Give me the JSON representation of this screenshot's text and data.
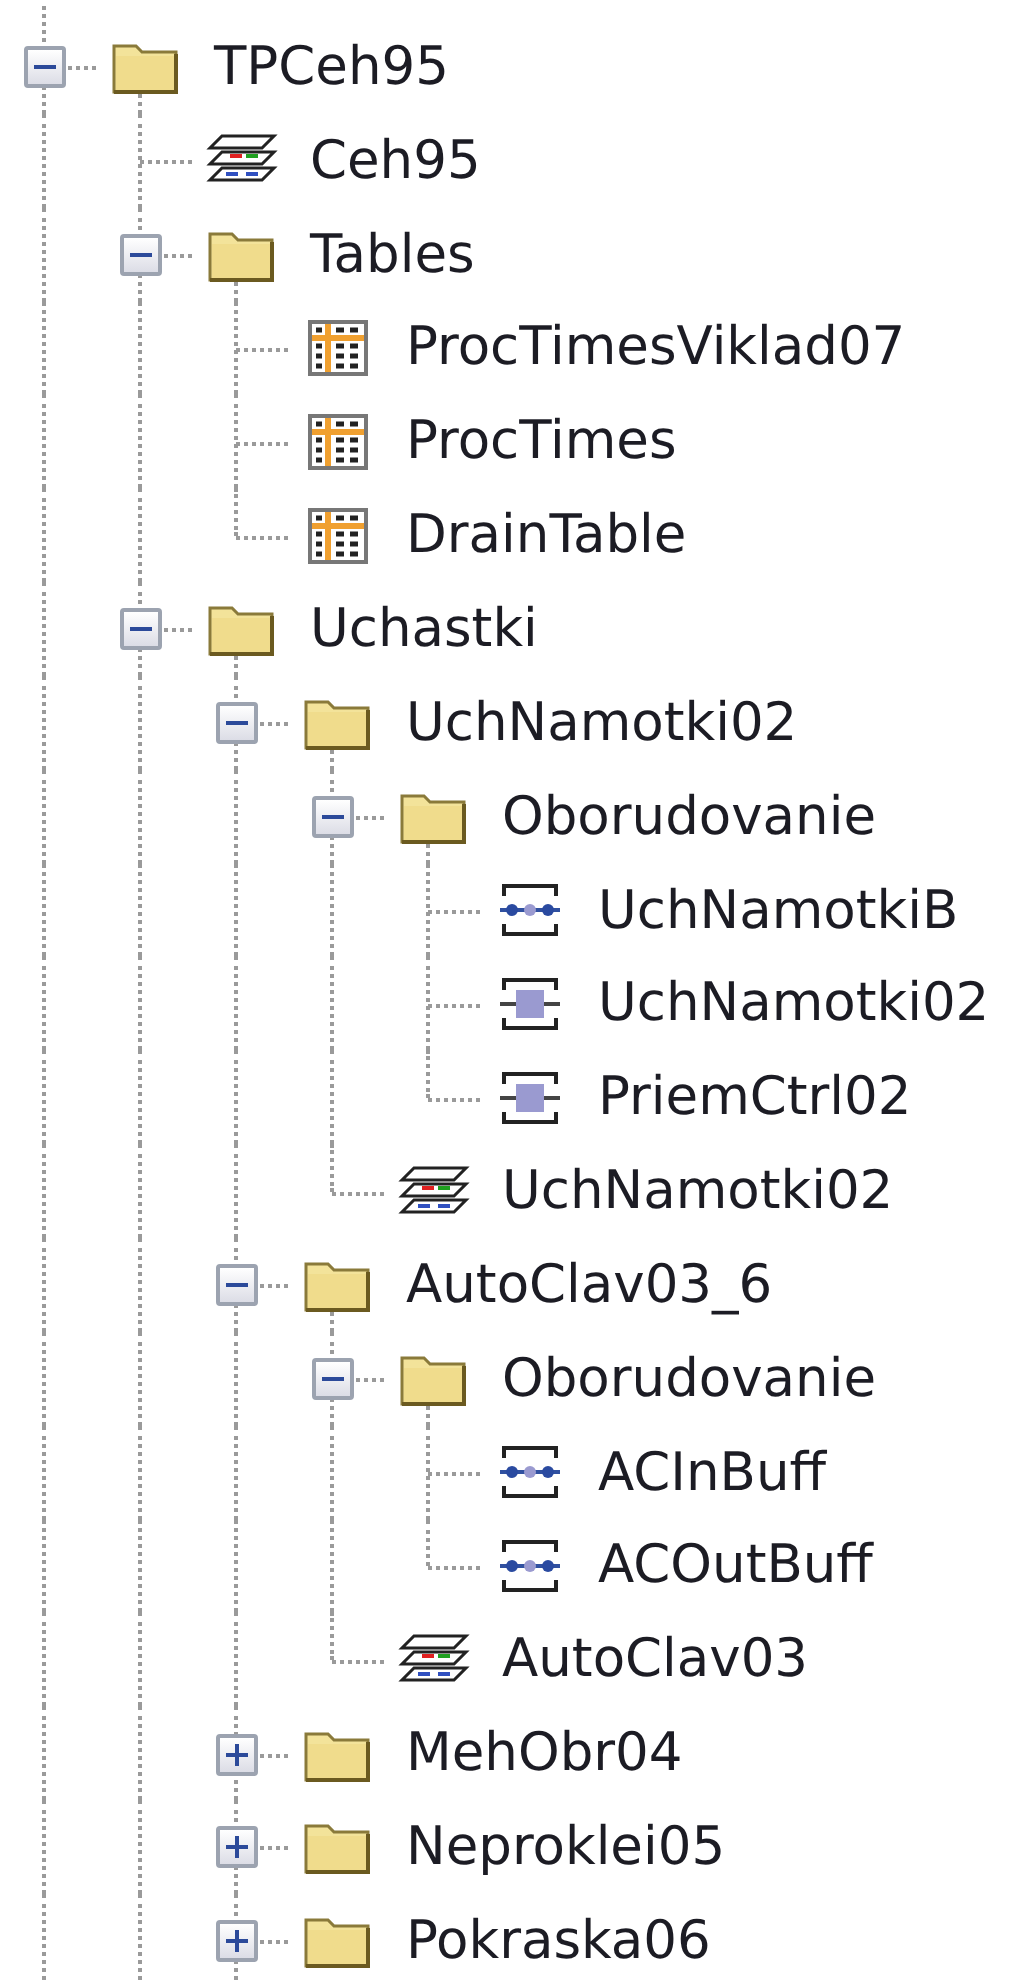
{
  "tree": [
    {
      "kind": "folder",
      "label": "TPCeh95",
      "expanded": true,
      "children": [
        {
          "kind": "diagram",
          "label": "Ceh95"
        },
        {
          "kind": "folder",
          "label": "Tables",
          "expanded": true,
          "children": [
            {
              "kind": "table",
              "label": "ProcTimesViklad07"
            },
            {
              "kind": "table",
              "label": "ProcTimes"
            },
            {
              "kind": "table",
              "label": "DrainTable"
            }
          ]
        },
        {
          "kind": "folder",
          "label": "Uchastki",
          "expanded": true,
          "children": [
            {
              "kind": "folder",
              "label": "UchNamotki02",
              "expanded": true,
              "children": [
                {
                  "kind": "folder",
                  "label": "Oborudovanie",
                  "expanded": true,
                  "children": [
                    {
                      "kind": "connector",
                      "label": "UchNamotkiB"
                    },
                    {
                      "kind": "block",
                      "label": "UchNamotki02"
                    },
                    {
                      "kind": "block",
                      "label": "PriemCtrl02"
                    }
                  ]
                },
                {
                  "kind": "diagram",
                  "label": "UchNamotki02"
                }
              ]
            },
            {
              "kind": "folder",
              "label": "AutoClav03_6",
              "expanded": true,
              "children": [
                {
                  "kind": "folder",
                  "label": "Oborudovanie",
                  "expanded": true,
                  "children": [
                    {
                      "kind": "connector",
                      "label": "ACInBuff"
                    },
                    {
                      "kind": "connector",
                      "label": "ACOutBuff"
                    }
                  ]
                },
                {
                  "kind": "diagram",
                  "label": "AutoClav03"
                }
              ]
            },
            {
              "kind": "folder",
              "label": "MehObr04",
              "expanded": false
            },
            {
              "kind": "folder",
              "label": "Neproklei05",
              "expanded": false
            },
            {
              "kind": "folder",
              "label": "Pokraska06",
              "expanded": false
            }
          ]
        }
      ]
    }
  ]
}
